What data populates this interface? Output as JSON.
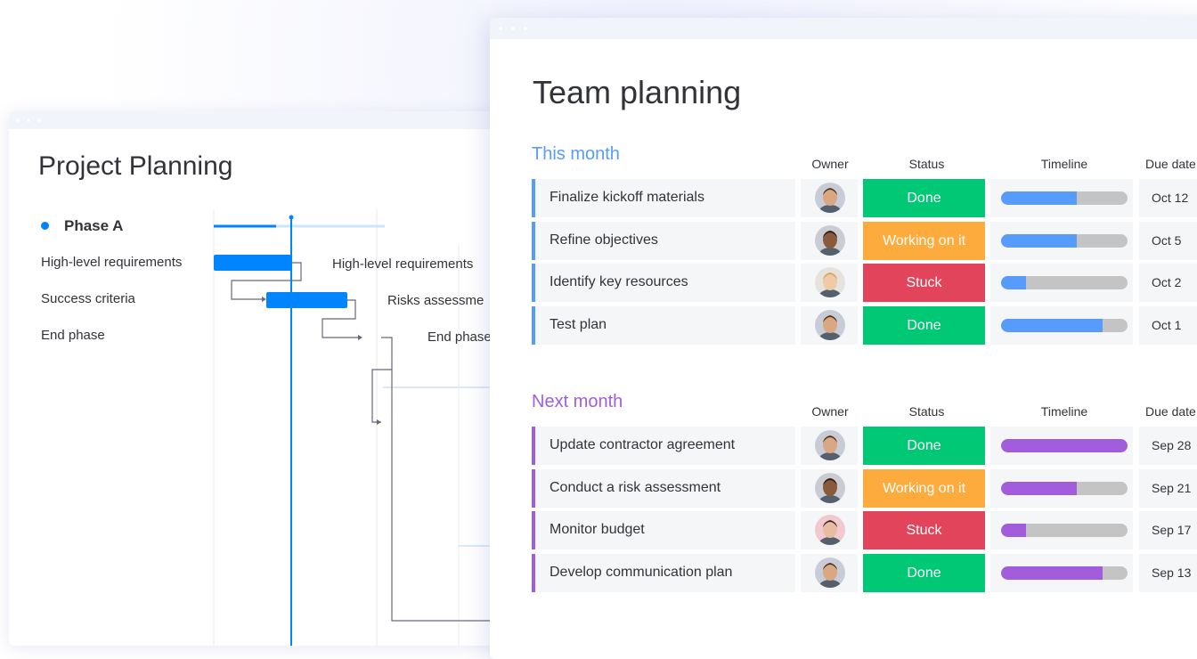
{
  "colors": {
    "accent_blue": "#0085ff",
    "group_this_month": "#579bfc",
    "group_next_month": "#a25ddc",
    "status_done": "#00c875",
    "status_working": "#fdab3d",
    "status_stuck": "#e2445c",
    "timeline_track": "#c4c4c4"
  },
  "project_planning": {
    "title": "Project Planning",
    "phase_label": "Phase A",
    "tasks": [
      "High-level requirements",
      "Success criteria",
      "End phase"
    ],
    "bar_labels": [
      "High-level requirements",
      "Risks assessme",
      "End phase"
    ]
  },
  "team_planning": {
    "title": "Team planning",
    "columns": {
      "owner": "Owner",
      "status": "Status",
      "timeline": "Timeline",
      "due_date": "Due date"
    },
    "groups": [
      {
        "title": "This month",
        "color": "#579bfc",
        "rows": [
          {
            "name": "Finalize kickoff materials",
            "status": "Done",
            "status_color": "#00c875",
            "timeline_progress": 0.6,
            "due": "Oct 12",
            "avatar": "man-beard-icon"
          },
          {
            "name": "Refine objectives",
            "status": "Working on it",
            "status_color": "#fdab3d",
            "timeline_progress": 0.6,
            "due": "Oct 5",
            "avatar": "man-dark-icon"
          },
          {
            "name": "Identify key resources",
            "status": "Stuck",
            "status_color": "#e2445c",
            "timeline_progress": 0.2,
            "due": "Oct 2",
            "avatar": "woman-blonde-icon"
          },
          {
            "name": "Test plan",
            "status": "Done",
            "status_color": "#00c875",
            "timeline_progress": 0.8,
            "due": "Oct 1",
            "avatar": "man-beard-icon"
          }
        ]
      },
      {
        "title": "Next month",
        "color": "#a25ddc",
        "rows": [
          {
            "name": "Update contractor agreement",
            "status": "Done",
            "status_color": "#00c875",
            "timeline_progress": 1.0,
            "due": "Sep 28",
            "avatar": "man-beard-icon"
          },
          {
            "name": "Conduct a risk assessment",
            "status": "Working on it",
            "status_color": "#fdab3d",
            "timeline_progress": 0.6,
            "due": "Sep 21",
            "avatar": "man-dark-icon"
          },
          {
            "name": "Monitor budget",
            "status": "Stuck",
            "status_color": "#e2445c",
            "timeline_progress": 0.2,
            "due": "Sep 17",
            "avatar": "woman-dark-icon"
          },
          {
            "name": "Develop communication plan",
            "status": "Done",
            "status_color": "#00c875",
            "timeline_progress": 0.8,
            "due": "Sep 13",
            "avatar": "man-beard-icon"
          }
        ]
      }
    ]
  }
}
